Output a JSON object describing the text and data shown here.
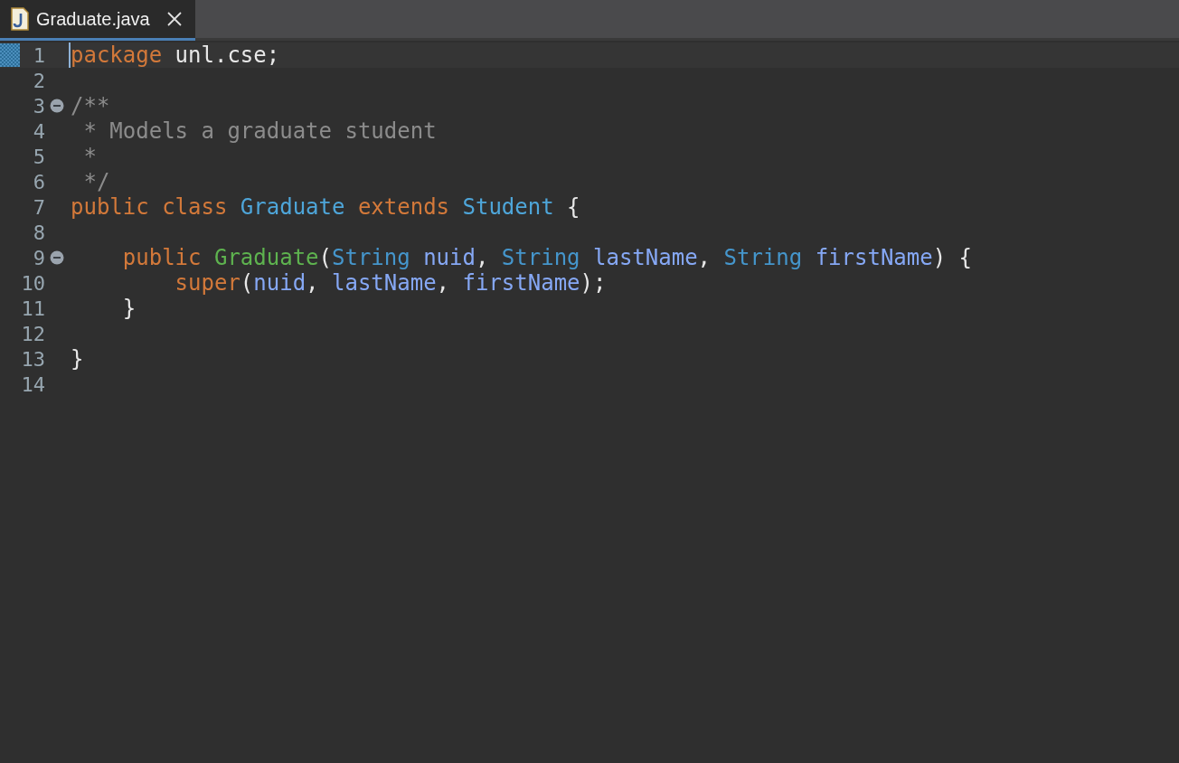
{
  "tabs": [
    {
      "title": "Graduate.java",
      "selected": true
    }
  ],
  "lines": [
    {
      "number": "1",
      "current": true,
      "tokens": [
        {
          "text": "package",
          "kind": "keyword"
        },
        {
          "text": " unl.cse;",
          "kind": "plain"
        }
      ]
    },
    {
      "number": "2",
      "current": false
    },
    {
      "number": "3",
      "current": false,
      "expanded": true,
      "tokens": [
        {
          "text": "/**",
          "kind": "comment"
        }
      ]
    },
    {
      "number": "4",
      "current": false,
      "tokens": [
        {
          "text": " * Models a graduate student",
          "kind": "comment"
        }
      ]
    },
    {
      "number": "5",
      "current": false,
      "tokens": [
        {
          "text": " *",
          "kind": "comment"
        }
      ]
    },
    {
      "number": "6",
      "current": false,
      "tokens": [
        {
          "text": " */",
          "kind": "comment"
        }
      ]
    },
    {
      "number": "7",
      "current": false,
      "tokens": [
        {
          "text": "public class ",
          "kind": "keyword"
        },
        {
          "text": "Graduate ",
          "kind": "class"
        },
        {
          "text": "extends ",
          "kind": "keyword"
        },
        {
          "text": "Student",
          "kind": "class"
        },
        {
          "text": " {",
          "kind": "plain"
        }
      ]
    },
    {
      "number": "8",
      "current": false
    },
    {
      "number": "9",
      "current": false,
      "expanded": true,
      "tokens": [
        {
          "text": "    public ",
          "kind": "keyword"
        },
        {
          "text": "Graduate",
          "kind": "method"
        },
        {
          "text": "(",
          "kind": "plain"
        },
        {
          "text": "String ",
          "kind": "type"
        },
        {
          "text": "nuid",
          "kind": "param"
        },
        {
          "text": ", ",
          "kind": "plain"
        },
        {
          "text": "String ",
          "kind": "type"
        },
        {
          "text": "lastName",
          "kind": "param"
        },
        {
          "text": ", ",
          "kind": "plain"
        },
        {
          "text": "String ",
          "kind": "type"
        },
        {
          "text": "firstName",
          "kind": "param"
        },
        {
          "text": ") {",
          "kind": "plain"
        }
      ]
    },
    {
      "number": "10",
      "current": false,
      "tokens": [
        {
          "text": "        super",
          "kind": "keyword"
        },
        {
          "text": "(",
          "kind": "plain"
        },
        {
          "text": "nuid",
          "kind": "param"
        },
        {
          "text": ", ",
          "kind": "plain"
        },
        {
          "text": "lastName",
          "kind": "param"
        },
        {
          "text": ", ",
          "kind": "plain"
        },
        {
          "text": "firstName",
          "kind": "param"
        },
        {
          "text": ");",
          "kind": "plain"
        }
      ]
    },
    {
      "number": "11",
      "current": false,
      "tokens": [
        {
          "text": "    }",
          "kind": "plain"
        }
      ]
    },
    {
      "number": "12",
      "current": false
    },
    {
      "number": "13",
      "current": false,
      "tokens": [
        {
          "text": "}",
          "kind": "plain"
        }
      ]
    },
    {
      "number": "14",
      "current": false
    }
  ]
}
